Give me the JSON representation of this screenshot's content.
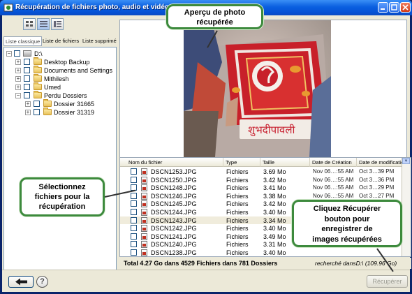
{
  "window": {
    "title": "Récupération de fichiers photo, audio et vidéo",
    "colors": {
      "titlebar": "#0552d6",
      "callout_border": "#3d8a3d",
      "face": "#ece9d8"
    }
  },
  "tabs": [
    {
      "label": "Liste classique"
    },
    {
      "label": "Liste de fichiers"
    },
    {
      "label": "Liste supprimé"
    }
  ],
  "tree": {
    "root": "D:\\",
    "items": [
      {
        "label": "Desktop Backup"
      },
      {
        "label": "Documents and Settings"
      },
      {
        "label": "Mithilesh"
      },
      {
        "label": "Umed"
      },
      {
        "label": "Perdu Dossiers"
      },
      {
        "label": "Dossier 31665"
      },
      {
        "label": "Dossier 31319"
      }
    ]
  },
  "columns": {
    "name": "Nom du fichier",
    "type": "Type",
    "size": "Taille",
    "created": "Date de Création",
    "modified": "Date de modificatio"
  },
  "files": [
    {
      "name": "DSCN1253.JPG",
      "type": "Fichiers",
      "size": "3.69 Mo",
      "created": "Nov 06…:55 AM",
      "modified": "Oct 3…39 PM"
    },
    {
      "name": "DSCN1250.JPG",
      "type": "Fichiers",
      "size": "3.42 Mo",
      "created": "Nov 06…:55 AM",
      "modified": "Oct 3…36 PM"
    },
    {
      "name": "DSCN1248.JPG",
      "type": "Fichiers",
      "size": "3.41 Mo",
      "created": "Nov 06…:55 AM",
      "modified": "Oct 3…29 PM"
    },
    {
      "name": "DSCN1246.JPG",
      "type": "Fichiers",
      "size": "3.38 Mo",
      "created": "Nov 06…:55 AM",
      "modified": "Oct 3…27 PM"
    },
    {
      "name": "DSCN1245.JPG",
      "type": "Fichiers",
      "size": "3.42 Mo",
      "created": "Nov 06…:55 AM",
      "modified": "Oct 3…18 PM"
    },
    {
      "name": "DSCN1244.JPG",
      "type": "Fichiers",
      "size": "3.40 Mo",
      "created": "",
      "modified": ""
    },
    {
      "name": "DSCN1243.JPG",
      "type": "Fichiers",
      "size": "3.34 Mo",
      "created": "",
      "modified": ""
    },
    {
      "name": "DSCN1242.JPG",
      "type": "Fichiers",
      "size": "3.40 Mo",
      "created": "",
      "modified": ""
    },
    {
      "name": "DSCN1241.JPG",
      "type": "Fichiers",
      "size": "3.49 Mo",
      "created": "",
      "modified": ""
    },
    {
      "name": "DSCN1240.JPG",
      "type": "Fichiers",
      "size": "3.31 Mo",
      "created": "",
      "modified": ""
    },
    {
      "name": "DSCN1238.JPG",
      "type": "Fichiers",
      "size": "3.40 Mo",
      "created": "",
      "modified": ""
    }
  ],
  "status": {
    "total": "Total 4.27 Go dans 4529 Fichiers dans 781 Dossiers",
    "search": "recherché dansD:\\ (109.96 Go)"
  },
  "buttons": {
    "back": "back-arrow-icon",
    "help": "?",
    "recover": "Récupérer"
  },
  "callouts": {
    "preview": [
      "Aperçu de photo",
      "récupérée"
    ],
    "select": [
      "Sélectionnez",
      "fichiers pour la",
      "récupération"
    ],
    "recover": [
      "Cliquez Récupérer",
      "bouton pour",
      "enregistrer de",
      "images récupérées"
    ]
  },
  "photo_text": "शुभदीपावली"
}
